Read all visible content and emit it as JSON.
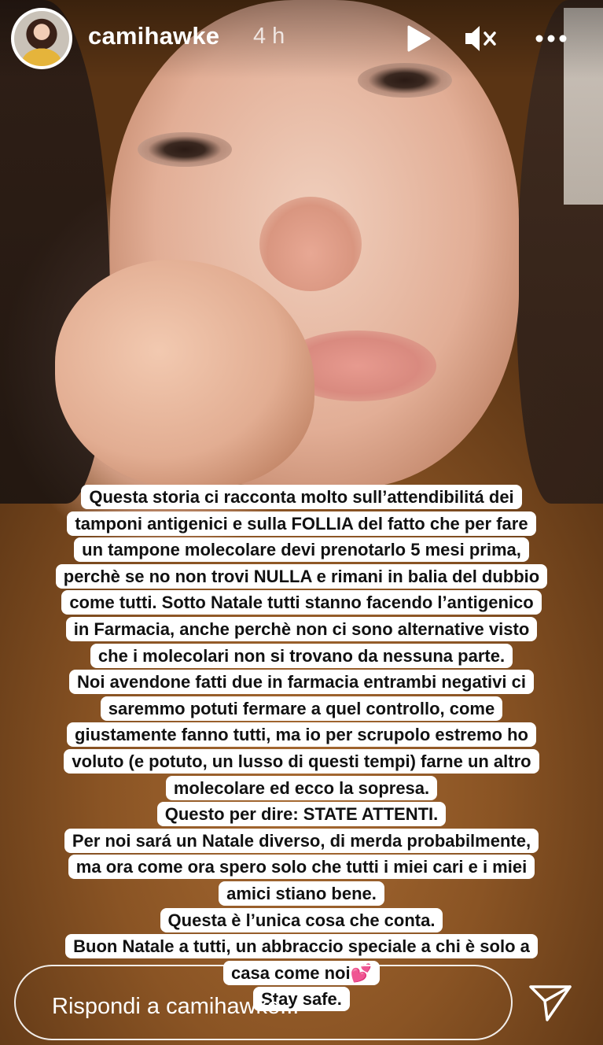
{
  "header": {
    "username": "camihawke",
    "timestamp": "4 h",
    "icons": {
      "play": "play-icon",
      "mute": "muted-speaker-icon",
      "more": "more-options-icon"
    }
  },
  "caption": {
    "lines": [
      "Questa storia ci racconta molto sull’attendibilitá dei",
      "tamponi antigenici e sulla FOLLIA del fatto che per fare",
      "un tampone molecolare devi prenotarlo 5 mesi prima,",
      "perchè se no non trovi NULLA e rimani in balia del dubbio",
      "come tutti. Sotto Natale tutti stanno facendo l’antigenico",
      "in Farmacia, anche perchè non ci sono alternative visto",
      "che i molecolari non si trovano da nessuna parte.",
      "Noi avendone fatti due in farmacia entrambi negativi ci",
      "saremmo potuti fermare a quel controllo, come",
      "giustamente fanno tutti, ma io per scrupolo estremo ho",
      "voluto (e potuto, un lusso di questi tempi) farne un altro",
      "molecolare ed ecco la sopresa.",
      "Questo per dire: STATE ATTENTI.",
      "Per noi sará un Natale diverso, di merda probabilmente,",
      "ma ora come ora spero solo che tutti i miei cari e i miei",
      "amici stiano bene.",
      "Questa è l’unica cosa che conta.",
      "Buon Natale a tutti, un abbraccio speciale a chi è solo a",
      "casa come noi💕",
      "Stay safe."
    ]
  },
  "reply": {
    "placeholder": "Rispondi a camihawke...",
    "send_icon": "send-icon"
  }
}
